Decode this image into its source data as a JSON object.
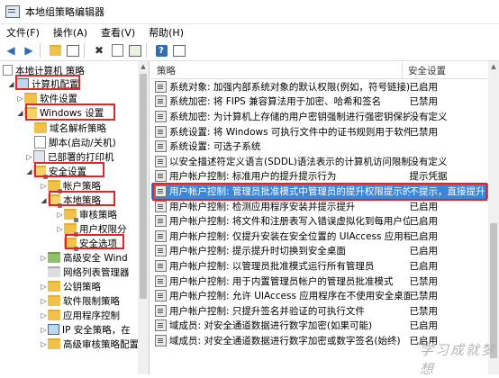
{
  "window": {
    "title": "本地组策略编辑器"
  },
  "menu": [
    {
      "label": "文件(F)"
    },
    {
      "label": "操作(A)"
    },
    {
      "label": "查看(V)"
    },
    {
      "label": "帮助(H)"
    }
  ],
  "tree": {
    "root": "本地计算机 策略",
    "computer_config": "计算机配置",
    "software_settings": "软件设置",
    "windows_settings": "Windows 设置",
    "name_resolution": "域名解析策略",
    "scripts": "脚本(启动/关机)",
    "printers": "已部署的打印机",
    "security_settings": "安全设置",
    "account_policies": "帐户策略",
    "local_policies": "本地策略",
    "audit_policy": "审核策略",
    "user_rights": "用户权限分",
    "security_options": "安全选项",
    "advanced_firewall": "高级安全 Wind",
    "network_list": "网络列表管理器",
    "public_key": "公钥策略",
    "software_restriction": "软件限制策略",
    "app_control": "应用程序控制",
    "ip_security": "IP 安全策略，在",
    "advanced_audit": "高级审核策略配置"
  },
  "columns": {
    "policy": "策略",
    "setting": "安全设置"
  },
  "policies": [
    {
      "name": "系统对象: 加强内部系统对象的默认权限(例如，符号链接)",
      "setting": "已启用"
    },
    {
      "name": "系统加密: 将 FIPS 兼容算法用于加密、哈希和签名",
      "setting": "已禁用"
    },
    {
      "name": "系统加密: 为计算机上存储的用户密钥强制进行强密钥保护",
      "setting": "没有定义"
    },
    {
      "name": "系统设置: 将 Windows 可执行文件中的证书规则用于软件...",
      "setting": "已禁用"
    },
    {
      "name": "系统设置: 可选子系统",
      "setting": ""
    },
    {
      "name": "以安全描述符定义语言(SDDL)语法表示的计算机访问限制",
      "setting": "没有定义"
    },
    {
      "name": "用户帐户控制: 标准用户的提升提示行为",
      "setting": "提示凭据"
    },
    {
      "name": "用户帐户控制: 管理员批准模式中管理员的提升权限提示的...",
      "setting": "不提示，直接提升"
    },
    {
      "name": "用户帐户控制: 检测应用程序安装并提示提升",
      "setting": "已启用"
    },
    {
      "name": "用户帐户控制: 将文件和注册表写入错误虚拟化到每用户位置",
      "setting": "已启用"
    },
    {
      "name": "用户帐户控制: 仅提升安装在安全位置的 UIAccess 应用程序",
      "setting": "已启用"
    },
    {
      "name": "用户帐户控制: 提示提升时切换到安全桌面",
      "setting": "已启用"
    },
    {
      "name": "用户帐户控制: 以管理员批准模式运行所有管理员",
      "setting": "已启用"
    },
    {
      "name": "用户帐户控制: 用于内置管理员帐户的管理员批准模式",
      "setting": "已禁用"
    },
    {
      "name": "用户帐户控制: 允许 UIAccess 应用程序在不使用安全桌面...",
      "setting": "已禁用"
    },
    {
      "name": "用户帐户控制: 只提升签名并验证的可执行文件",
      "setting": "已禁用"
    },
    {
      "name": "域成员: 对安全通道数据进行数字加密(如果可能)",
      "setting": "已启用"
    },
    {
      "name": "域成员: 对安全通道数据进行数字加密或数字签名(始终)",
      "setting": "已启用"
    }
  ],
  "watermark": "学习成就梦想"
}
